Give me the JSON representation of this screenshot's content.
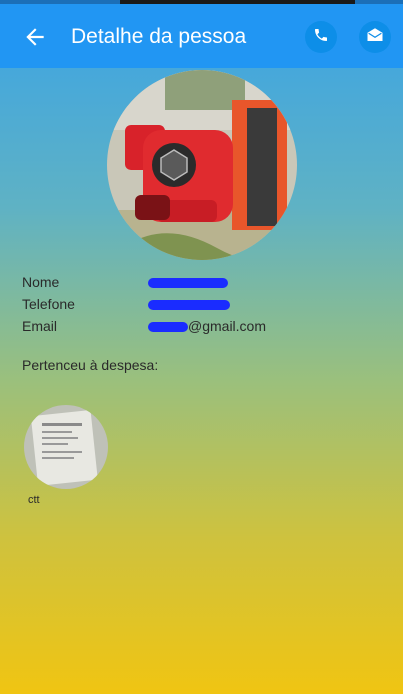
{
  "appbar": {
    "title": "Detalhe da pessoa",
    "back_icon": "arrow-left-icon",
    "actions": [
      {
        "icon": "phone-icon"
      },
      {
        "icon": "mail-icon"
      }
    ],
    "color": "#2196f3"
  },
  "person": {
    "photo_icon": "fire-hydrant-photo",
    "fields": [
      {
        "label": "Nome",
        "value": ""
      },
      {
        "label": "Telefone",
        "value": ""
      },
      {
        "label": "Email",
        "value": "@gmail.com"
      }
    ]
  },
  "expenses": {
    "section_title": "Pertenceu à despesa:",
    "items": [
      {
        "label": "ctt",
        "image": "receipt-photo"
      }
    ]
  }
}
